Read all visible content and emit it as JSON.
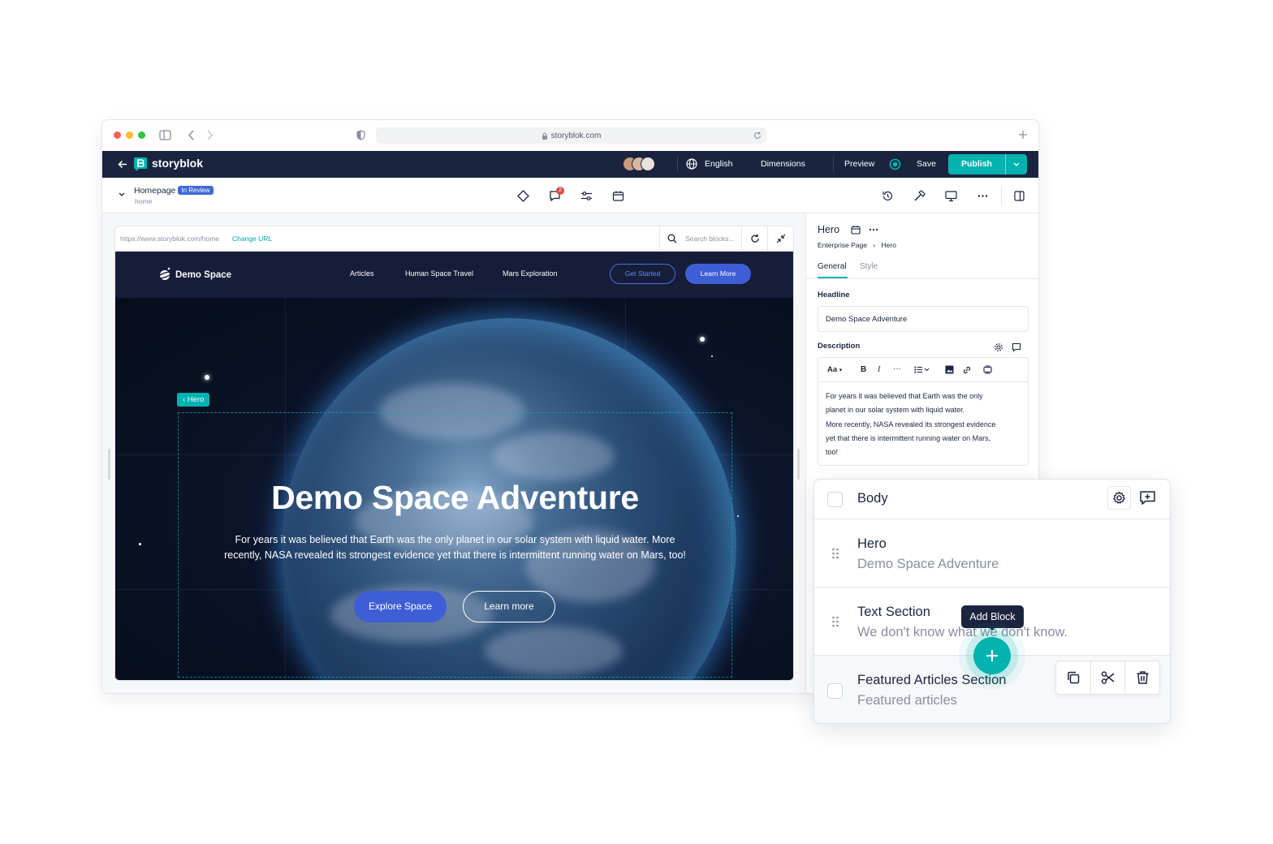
{
  "browser": {
    "url": "storyblok.com"
  },
  "appbar": {
    "brand": "storyblok",
    "language": "English",
    "dimensions": "Dimensions",
    "preview": "Preview",
    "save": "Save",
    "publish": "Publish"
  },
  "toolbar": {
    "story_name": "Homepage",
    "status_badge": "In Review",
    "slug": "home",
    "comments_count": "2"
  },
  "preview_bar": {
    "url": "https://www.storyblok.com/home",
    "change_url": "Change URL",
    "search_placeholder": "Search blocks..."
  },
  "site": {
    "logo": "Demo Space",
    "nav": [
      "Articles",
      "Human Space Travel",
      "Mars Exploration"
    ],
    "get_started": "Get Started",
    "learn_more_nav": "Learn More",
    "hero_tag": "Hero",
    "headline": "Demo Space Adventure",
    "description": "For years it was believed that Earth was the only planet in our solar system with liquid water. More recently, NASA revealed its strongest evidence yet that there is intermittent running water on Mars, too!",
    "explore": "Explore Space",
    "learn_more": "Learn more"
  },
  "panel": {
    "title": "Hero",
    "breadcrumb": [
      "Enterprise Page",
      "Hero"
    ],
    "tabs": [
      "General",
      "Style"
    ],
    "headline_label": "Headline",
    "headline_value": "Demo Space Adventure",
    "description_label": "Description",
    "text_style": "Aa",
    "description_lines": [
      "For years it was believed that Earth was the only",
      "planet in our solar system with liquid water.",
      "More recently, NASA revealed its strongest evidence",
      "yet that there is intermittent running water on Mars,",
      "too!"
    ]
  },
  "body_card": {
    "title": "Body",
    "items": [
      {
        "title": "Hero",
        "subtitle": "Demo Space Adventure"
      },
      {
        "title": "Text Section",
        "subtitle": "We don't know what we don't know."
      },
      {
        "title": "Featured Articles Section",
        "subtitle": "Featured articles"
      }
    ],
    "add_block_tooltip": "Add Block"
  },
  "colors": {
    "brand_dark": "#1b243f",
    "accent_teal": "#00b3b0",
    "button_blue": "#3e5ed6"
  }
}
